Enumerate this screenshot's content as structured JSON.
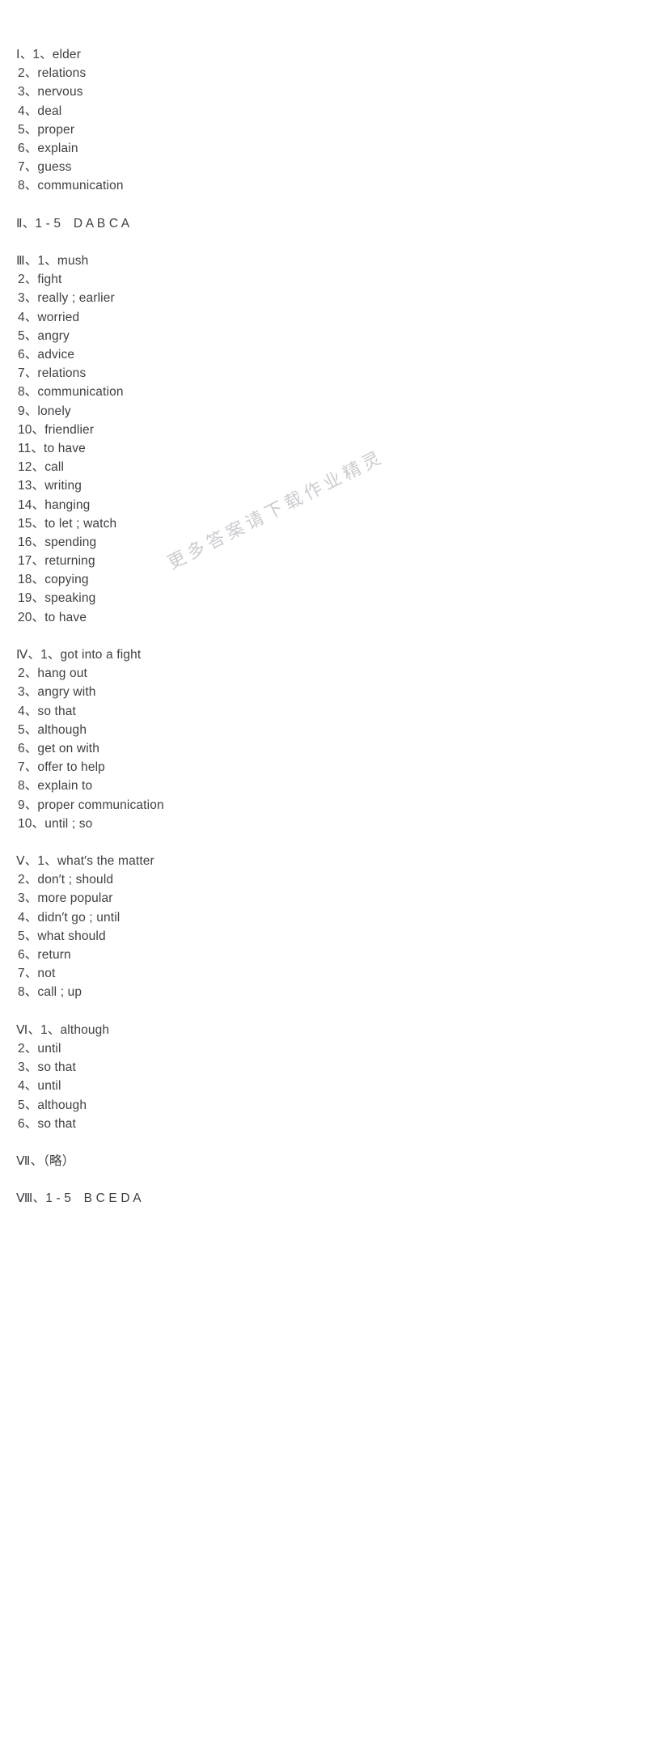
{
  "document": {
    "type": "answer-key",
    "text_color": "#3f3f44",
    "background_color": "#ffffff"
  },
  "watermark": {
    "text": "更多答案请下载作业精灵",
    "color": "#c9c9cf",
    "rotation_deg": -27
  },
  "lines": [
    {
      "id": "l1",
      "text": "Ⅰ、1、elder",
      "kind": "section-head"
    },
    {
      "id": "l2",
      "text": "2、relations",
      "kind": "item"
    },
    {
      "id": "l3",
      "text": "3、nervous",
      "kind": "item"
    },
    {
      "id": "l4",
      "text": "4、deal",
      "kind": "item"
    },
    {
      "id": "l5",
      "text": "5、proper",
      "kind": "item"
    },
    {
      "id": "l6",
      "text": "6、explain",
      "kind": "item"
    },
    {
      "id": "l7",
      "text": "7、guess",
      "kind": "item"
    },
    {
      "id": "l8",
      "text": "8、communication",
      "kind": "item"
    },
    {
      "id": "l9",
      "text": " ",
      "kind": "blank"
    },
    {
      "id": "l10",
      "text": "Ⅱ、1 - 5　D A B C A",
      "kind": "section-head"
    },
    {
      "id": "l11",
      "text": " ",
      "kind": "blank"
    },
    {
      "id": "l12",
      "text": "Ⅲ、1、mush",
      "kind": "section-head"
    },
    {
      "id": "l13",
      "text": "2、fight",
      "kind": "item"
    },
    {
      "id": "l14",
      "text": "3、really ; earlier",
      "kind": "item"
    },
    {
      "id": "l15",
      "text": "4、worried",
      "kind": "item"
    },
    {
      "id": "l16",
      "text": "5、angry",
      "kind": "item"
    },
    {
      "id": "l17",
      "text": "6、advice",
      "kind": "item"
    },
    {
      "id": "l18",
      "text": "7、relations",
      "kind": "item"
    },
    {
      "id": "l19",
      "text": "8、communication",
      "kind": "item"
    },
    {
      "id": "l20",
      "text": "9、lonely",
      "kind": "item"
    },
    {
      "id": "l21",
      "text": "10、friendlier",
      "kind": "item"
    },
    {
      "id": "l22",
      "text": "11、to have",
      "kind": "item"
    },
    {
      "id": "l23",
      "text": "12、call",
      "kind": "item"
    },
    {
      "id": "l24",
      "text": "13、writing",
      "kind": "item"
    },
    {
      "id": "l25",
      "text": "14、hanging",
      "kind": "item"
    },
    {
      "id": "l26",
      "text": "15、to let ; watch",
      "kind": "item"
    },
    {
      "id": "l27",
      "text": "16、spending",
      "kind": "item"
    },
    {
      "id": "l28",
      "text": "17、returning",
      "kind": "item"
    },
    {
      "id": "l29",
      "text": "18、copying",
      "kind": "item"
    },
    {
      "id": "l30",
      "text": "19、speaking",
      "kind": "item"
    },
    {
      "id": "l31",
      "text": "20、to have",
      "kind": "item"
    },
    {
      "id": "l32",
      "text": " ",
      "kind": "blank"
    },
    {
      "id": "l33",
      "text": "Ⅳ、1、got into a fight",
      "kind": "section-head"
    },
    {
      "id": "l34",
      "text": "2、hang out",
      "kind": "item"
    },
    {
      "id": "l35",
      "text": "3、angry with",
      "kind": "item"
    },
    {
      "id": "l36",
      "text": "4、so that",
      "kind": "item"
    },
    {
      "id": "l37",
      "text": "5、although",
      "kind": "item"
    },
    {
      "id": "l38",
      "text": "6、get on with",
      "kind": "item"
    },
    {
      "id": "l39",
      "text": "7、offer to help",
      "kind": "item"
    },
    {
      "id": "l40",
      "text": "8、explain to",
      "kind": "item"
    },
    {
      "id": "l41",
      "text": "9、proper communication",
      "kind": "item"
    },
    {
      "id": "l42",
      "text": "10、until ; so",
      "kind": "item"
    },
    {
      "id": "l43",
      "text": " ",
      "kind": "blank"
    },
    {
      "id": "l44",
      "text": "Ⅴ、1、what′s the matter",
      "kind": "section-head"
    },
    {
      "id": "l45",
      "text": "2、don′t ; should",
      "kind": "item"
    },
    {
      "id": "l46",
      "text": "3、more popular",
      "kind": "item"
    },
    {
      "id": "l47",
      "text": "4、didn′t go ; until",
      "kind": "item"
    },
    {
      "id": "l48",
      "text": "5、what should",
      "kind": "item"
    },
    {
      "id": "l49",
      "text": "6、return",
      "kind": "item"
    },
    {
      "id": "l50",
      "text": "7、not",
      "kind": "item"
    },
    {
      "id": "l51",
      "text": "8、call ; up",
      "kind": "item"
    },
    {
      "id": "l52",
      "text": " ",
      "kind": "blank"
    },
    {
      "id": "l53",
      "text": "Ⅵ、1、although",
      "kind": "section-head"
    },
    {
      "id": "l54",
      "text": "2、until",
      "kind": "item"
    },
    {
      "id": "l55",
      "text": "3、so that",
      "kind": "item"
    },
    {
      "id": "l56",
      "text": "4、until",
      "kind": "item"
    },
    {
      "id": "l57",
      "text": "5、although",
      "kind": "item"
    },
    {
      "id": "l58",
      "text": "6、so that",
      "kind": "item"
    },
    {
      "id": "l59",
      "text": " ",
      "kind": "blank"
    },
    {
      "id": "l60",
      "text": "Ⅶ、（略）",
      "kind": "section-head"
    },
    {
      "id": "l61",
      "text": " ",
      "kind": "blank"
    },
    {
      "id": "l62",
      "text": "Ⅷ、1 - 5　B C E D A",
      "kind": "section-head"
    }
  ]
}
